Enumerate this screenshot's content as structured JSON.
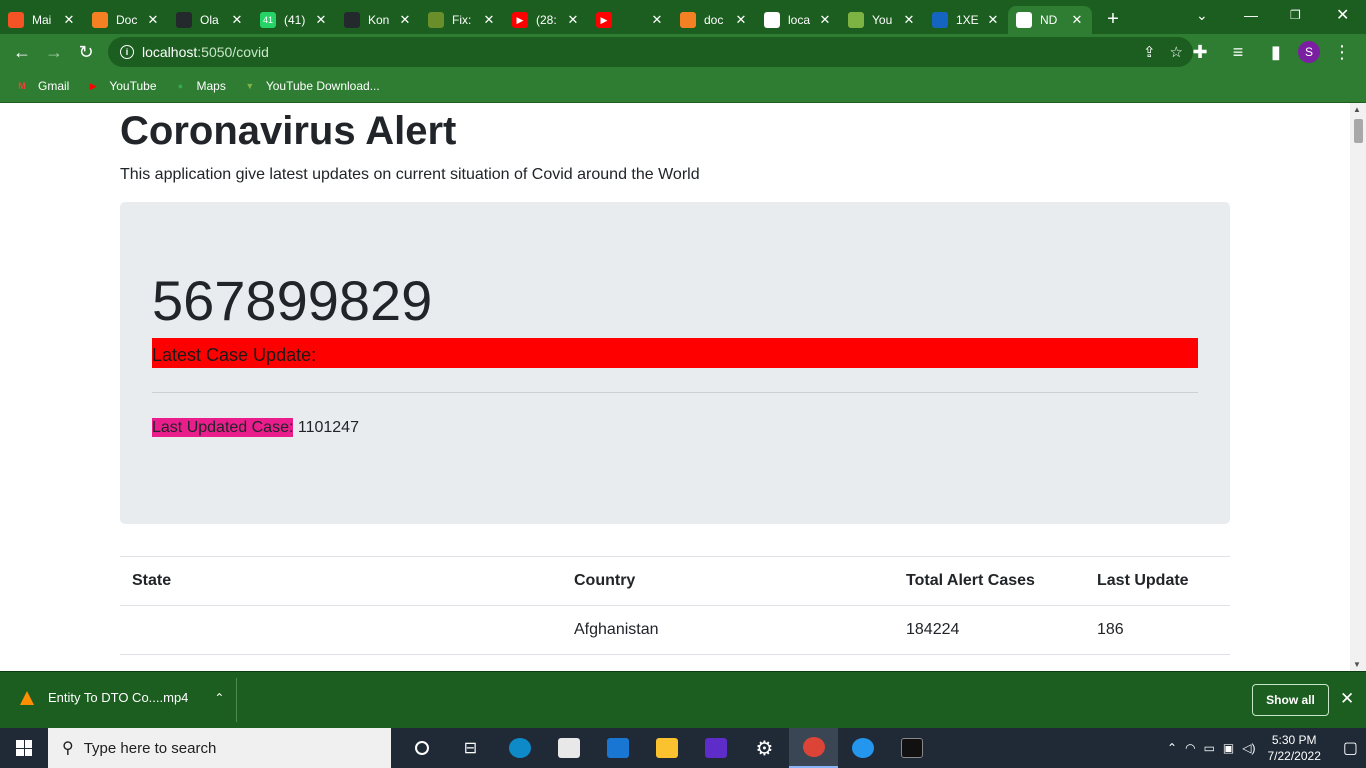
{
  "browser": {
    "tabs": [
      {
        "title": "Mai",
        "fav_color": "#f35325",
        "fav_glyph": "",
        "icon": "microsoft-icon"
      },
      {
        "title": "Doc",
        "fav_color": "#f48024",
        "fav_glyph": "",
        "icon": "stackoverflow-icon"
      },
      {
        "title": "Ola",
        "fav_color": "#24292e",
        "fav_glyph": "",
        "icon": "github-icon"
      },
      {
        "title": "(41)",
        "fav_color": "#25d366",
        "fav_glyph": "41",
        "icon": "whatsapp-icon"
      },
      {
        "title": "Kon",
        "fav_color": "#24292e",
        "fav_glyph": "",
        "icon": "github-icon"
      },
      {
        "title": "Fix:",
        "fav_color": "#6a8f2a",
        "fav_glyph": "",
        "icon": "leaf-icon"
      },
      {
        "title": "(28:",
        "fav_color": "#ff0000",
        "fav_glyph": "▶",
        "icon": "youtube-icon"
      },
      {
        "title": "",
        "fav_color": "#ff0000",
        "fav_glyph": "▶",
        "icon": "youtube-icon"
      },
      {
        "title": "doc",
        "fav_color": "#f48024",
        "fav_glyph": "",
        "icon": "stackoverflow-icon"
      },
      {
        "title": "loca",
        "fav_color": "#ffffff",
        "fav_glyph": "",
        "icon": "globe-icon"
      },
      {
        "title": "You",
        "fav_color": "#7cb342",
        "fav_glyph": "",
        "icon": "download-icon"
      },
      {
        "title": "1XE",
        "fav_color": "#1565c0",
        "fav_glyph": "",
        "icon": "xe-icon"
      },
      {
        "title": "ND",
        "fav_color": "#ffffff",
        "fav_glyph": "",
        "icon": "globe-icon"
      }
    ],
    "url_host": "localhost",
    "url_path": ":5050/covid",
    "profile_initial": "S",
    "bookmarks": [
      {
        "label": "Gmail",
        "color": "#ea4335",
        "glyph": "M",
        "icon": "gmail-icon"
      },
      {
        "label": "YouTube",
        "color": "#ff0000",
        "glyph": "▶",
        "icon": "youtube-icon"
      },
      {
        "label": "Maps",
        "color": "#34a853",
        "glyph": "●",
        "icon": "maps-icon"
      },
      {
        "label": "YouTube Download...",
        "color": "#7cb342",
        "glyph": "▼",
        "icon": "download-icon"
      }
    ]
  },
  "page": {
    "title": "Coronavirus Alert",
    "lead": "This application give latest updates on current situation of Covid around the World",
    "total_cases": "567899829",
    "latest_label": "Latest Case Update:",
    "last_updated_label": "Last Updated Case:",
    "last_updated_value": "1101247",
    "table": {
      "headers": [
        "State",
        "Country",
        "Total Alert Cases",
        "Last Update"
      ],
      "rows": [
        [
          "",
          "Afghanistan",
          "184224",
          "186"
        ]
      ]
    }
  },
  "download": {
    "filename": "Entity To DTO Co....mp4",
    "show_all": "Show all"
  },
  "taskbar": {
    "search_placeholder": "Type here to search",
    "time": "5:30 PM",
    "date": "7/22/2022"
  },
  "colors": {
    "accent_green": "#2e7d32",
    "latest_bar": "#ff0000",
    "last_updated_highlight": "#e91e8c"
  }
}
